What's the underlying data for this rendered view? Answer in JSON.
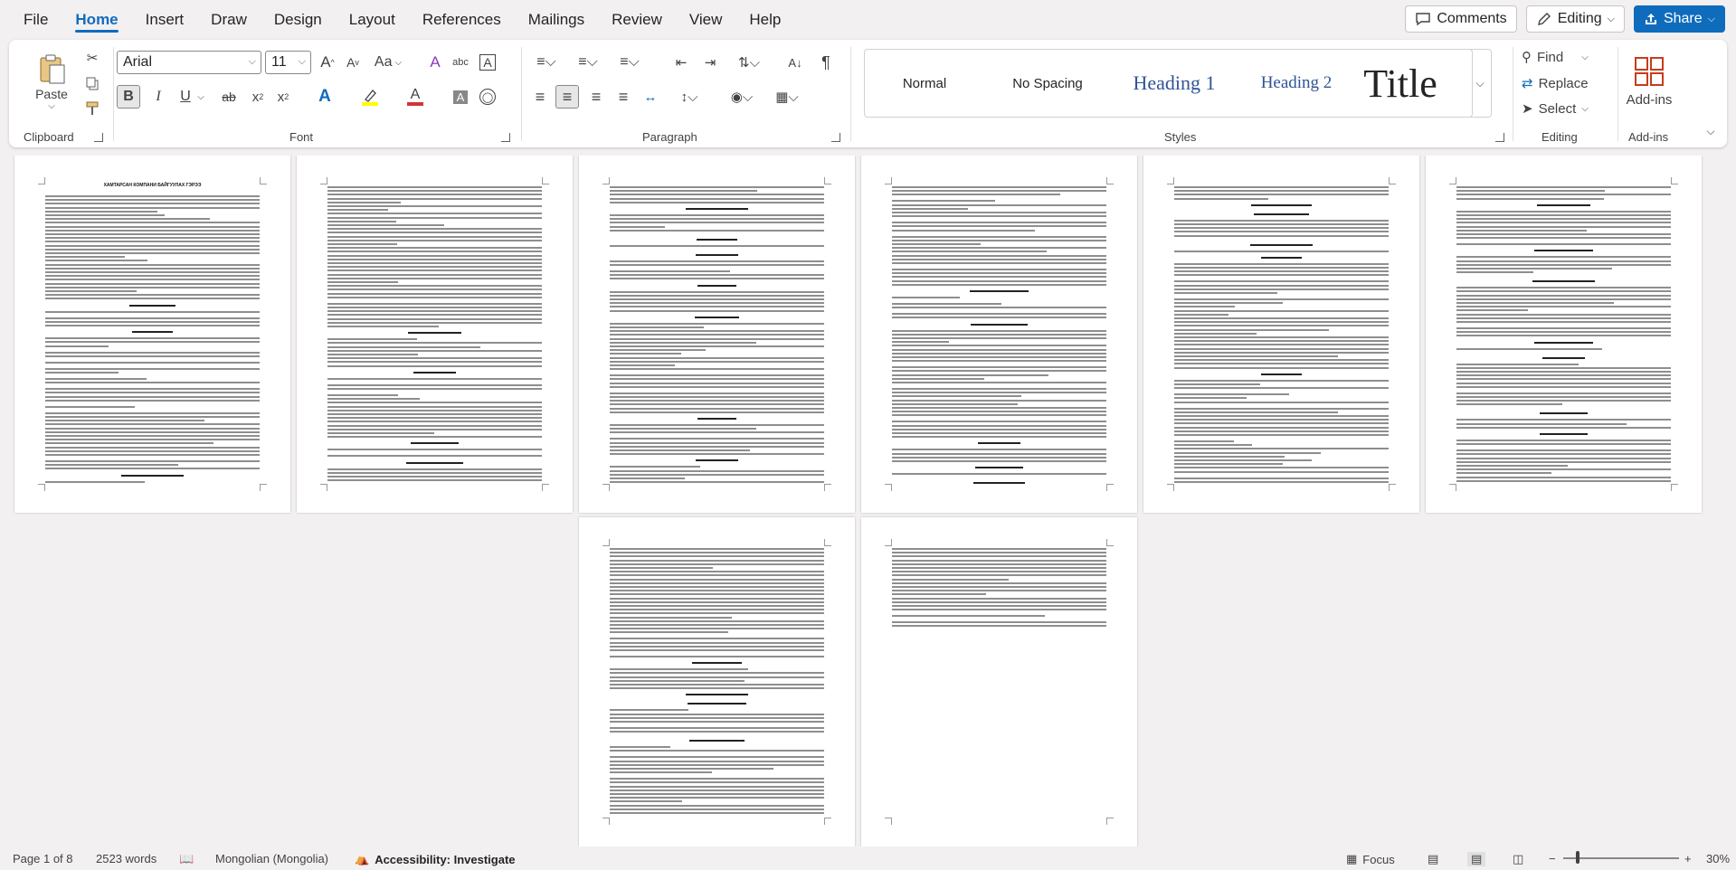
{
  "menu": {
    "tabs": [
      "File",
      "Home",
      "Insert",
      "Draw",
      "Design",
      "Layout",
      "References",
      "Mailings",
      "Review",
      "View",
      "Help"
    ],
    "active": "Home",
    "comments_label": "Comments",
    "editing_label": "Editing",
    "share_label": "Share"
  },
  "ribbon": {
    "clipboard": {
      "label": "Clipboard",
      "paste_label": "Paste"
    },
    "font": {
      "label": "Font",
      "font_name": "Arial",
      "font_size": "11",
      "change_case": "Aa"
    },
    "paragraph": {
      "label": "Paragraph"
    },
    "styles": {
      "label": "Styles",
      "items": [
        "Normal",
        "No Spacing",
        "Heading 1",
        "Heading 2",
        "Title"
      ]
    },
    "editing": {
      "label": "Editing",
      "find": "Find",
      "replace": "Replace",
      "select": "Select"
    },
    "addins": {
      "label": "Add-ins",
      "button": "Add-ins"
    }
  },
  "pages": [
    {
      "title": "ХАМТАРСАН КОМПАНИ БАЙГУУЛАХ ГЭРЭЭ"
    },
    {
      "title": ""
    },
    {
      "title": ""
    },
    {
      "title": ""
    },
    {
      "title": ""
    },
    {
      "title": ""
    },
    {
      "title": ""
    },
    {
      "title": ""
    }
  ],
  "statusbar": {
    "page": "Page 1 of 8",
    "words": "2523 words",
    "language": "Mongolian (Mongolia)",
    "accessibility": "Accessibility: Investigate",
    "focus": "Focus",
    "zoom": "30%"
  },
  "colors": {
    "accent": "#0f6cbd",
    "highlight": "#ffff00",
    "font_color": "#d13438",
    "heading": "#2f5496"
  }
}
